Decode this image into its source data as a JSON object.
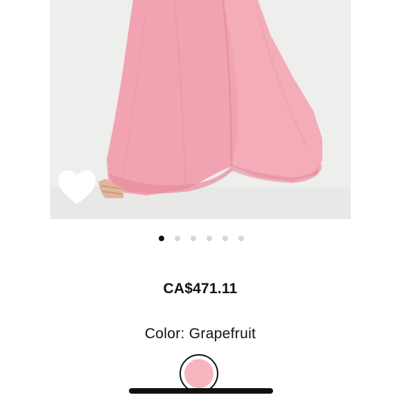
{
  "product": {
    "price": "CA$471.11",
    "color_label": "Color:",
    "color_name": "Grapefruit",
    "color_hex": "#f7b5bf"
  },
  "image_carousel": {
    "total_images": 6,
    "active_index": 0
  },
  "wishlist": {
    "icon": "heart-icon",
    "state": "not-saved"
  },
  "colors": {
    "dress_pink": "#f2a3b1",
    "dress_shadow": "#e58b9c",
    "backdrop": "#eeeeec",
    "dot_active": "#111111",
    "dot_inactive": "#d6d6d6"
  }
}
